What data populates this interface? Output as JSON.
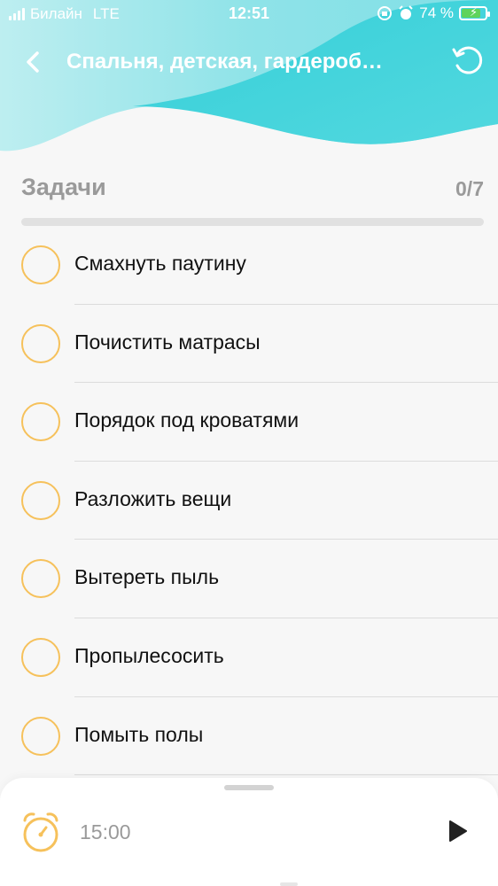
{
  "status_bar": {
    "carrier": "Билайн",
    "network": "LTE",
    "time": "12:51",
    "battery_percent_label": "74 %",
    "battery_level": 0.74
  },
  "header": {
    "title": "Спальня, детская, гардероб…",
    "back_icon": "chevron-left-icon",
    "reset_icon": "refresh-icon"
  },
  "tasks": {
    "title": "Задачи",
    "count": "0/7",
    "progress": 0,
    "items": [
      {
        "label": "Смахнуть паутину",
        "done": false
      },
      {
        "label": "Почистить матрасы",
        "done": false
      },
      {
        "label": "Порядок под кроватями",
        "done": false
      },
      {
        "label": "Разложить вещи",
        "done": false
      },
      {
        "label": "Вытереть пыль",
        "done": false
      },
      {
        "label": "Пропылесосить",
        "done": false
      },
      {
        "label": "Помыть полы",
        "done": false
      }
    ]
  },
  "timer": {
    "value": "15:00",
    "icon": "alarm-clock-icon",
    "play_icon": "play-icon"
  },
  "colors": {
    "accent_teal": "#4bd5dc",
    "check_orange": "#f6c15b",
    "muted_text": "#9a9a9a"
  }
}
